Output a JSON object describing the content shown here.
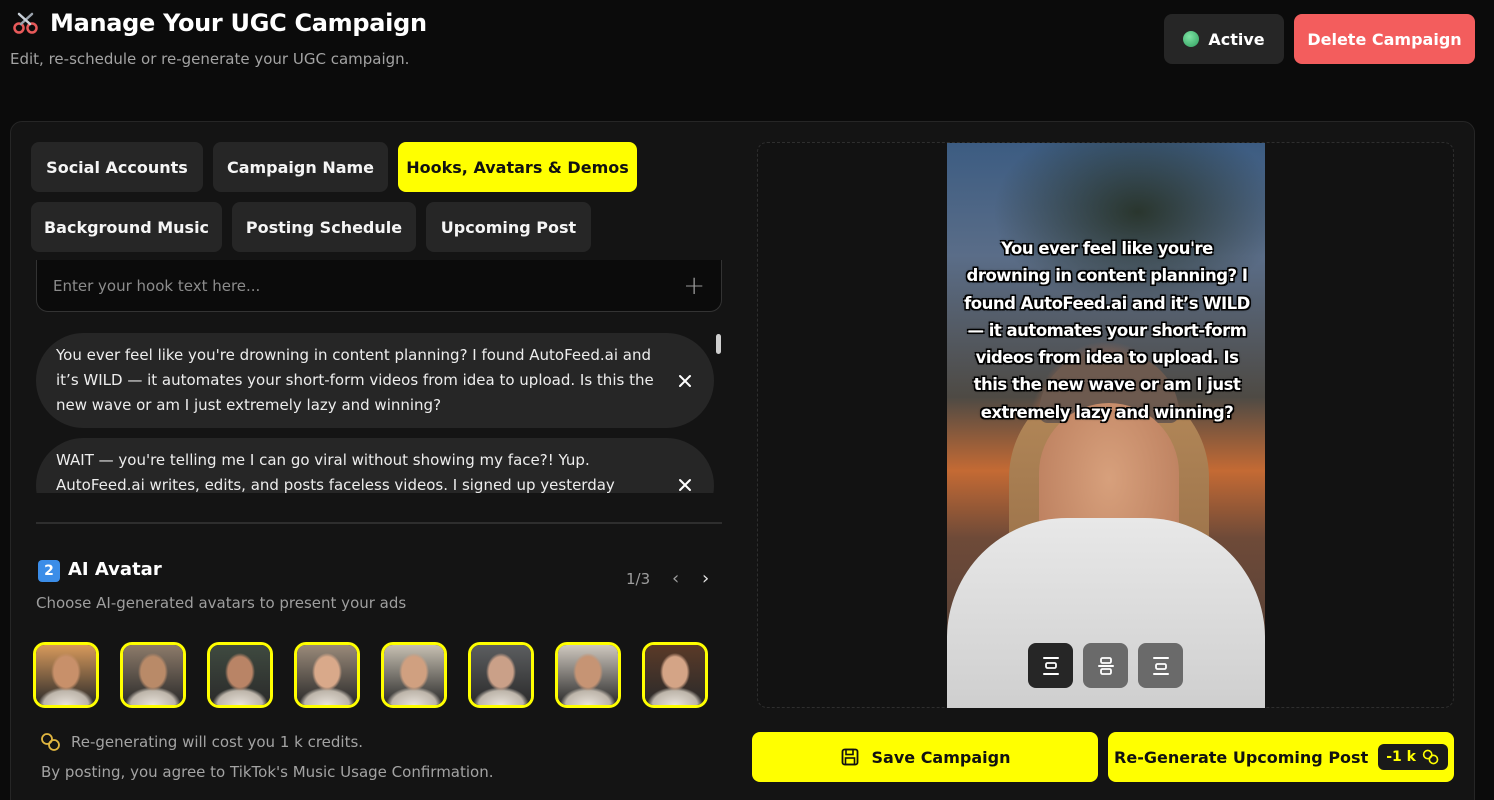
{
  "header": {
    "title": "Manage Your UGC Campaign",
    "subtitle": "Edit, re-schedule or re-generate your UGC campaign.",
    "status_label": "Active",
    "delete_label": "Delete Campaign"
  },
  "tabs": [
    {
      "label": "Social Accounts",
      "active": false
    },
    {
      "label": "Campaign Name",
      "active": false
    },
    {
      "label": "Hooks, Avatars & Demos",
      "active": true
    },
    {
      "label": "Background Music",
      "active": false
    },
    {
      "label": "Posting Schedule",
      "active": false
    },
    {
      "label": "Upcoming Post",
      "active": false
    }
  ],
  "hooks": {
    "input_placeholder": "Enter your hook text here...",
    "items": [
      "You ever feel like you're drowning in content planning? I found AutoFeed.ai and it’s WILD — it automates your short-form videos from idea to upload. Is this the new wave or am I just extremely lazy and winning?",
      "WAIT — you're telling me I can go viral without showing my face?! Yup. AutoFeed.ai writes, edits, and posts faceless videos. I signed up yesterday"
    ]
  },
  "avatar_section": {
    "badge": "2",
    "title": "AI Avatar",
    "subtitle": "Choose AI-generated avatars to present your ads",
    "pager": "1/3",
    "avatars": [
      {
        "name": "avatar-1",
        "skin": "#c8906a",
        "bg": "#d89a5c"
      },
      {
        "name": "avatar-2",
        "skin": "#b98a68",
        "bg": "#8d7b6a"
      },
      {
        "name": "avatar-3",
        "skin": "#b98466",
        "bg": "#3f4a40"
      },
      {
        "name": "avatar-4",
        "skin": "#d9a98a",
        "bg": "#9a8a7a"
      },
      {
        "name": "avatar-5",
        "skin": "#d0a080",
        "bg": "#c7c0b2"
      },
      {
        "name": "avatar-6",
        "skin": "#caa088",
        "bg": "#5c5e60"
      },
      {
        "name": "avatar-7",
        "skin": "#c69474",
        "bg": "#cfc8bf"
      },
      {
        "name": "avatar-8",
        "skin": "#d4a486",
        "bg": "#5a3a28"
      }
    ]
  },
  "notes": {
    "credit_note": "Re-generating will cost you 1 k credits.",
    "music_note": "By posting, you agree to TikTok's Music Usage Confirmation."
  },
  "preview": {
    "overlay_text": "You ever feel like you're drowning in content planning? I found AutoFeed.ai and it’s WILD — it automates your short-form videos from idea to upload. Is this the new wave or am I just extremely lazy and winning?",
    "position_options": [
      "top",
      "middle",
      "bottom"
    ],
    "selected_position": "top"
  },
  "actions": {
    "save_label": "Save Campaign",
    "regen_label": "Re-Generate Upcoming Post",
    "regen_cost": "-1 k"
  },
  "colors": {
    "accent": "#ffff00",
    "danger": "#f35d5d",
    "status": "#3fbf6f",
    "background": "#0b0b0b"
  }
}
